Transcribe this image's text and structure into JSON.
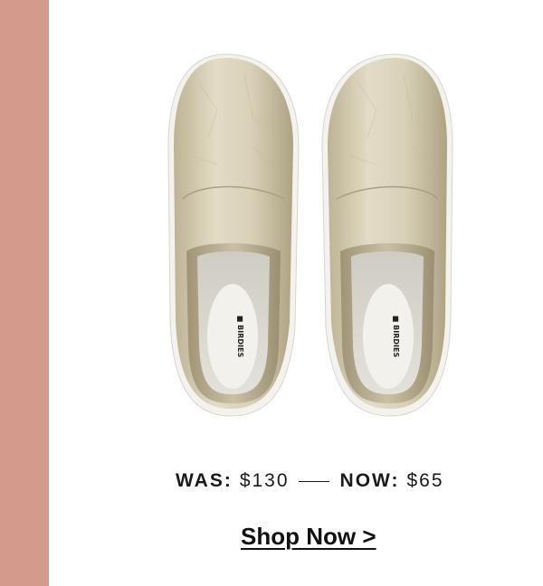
{
  "banner": {
    "image_alt": "Gold metallic slip-on sneakers, top view",
    "insole_brand": "BIRDIES"
  },
  "price": {
    "was_label": "WAS:",
    "was_value": "$130",
    "now_label": "NOW:",
    "now_value": "$65"
  },
  "cta": {
    "label": "Shop Now >"
  },
  "colors": {
    "side_band": "#d49a8b",
    "text": "#1a1a1a",
    "shoe_gold": "#cfc6aa"
  }
}
